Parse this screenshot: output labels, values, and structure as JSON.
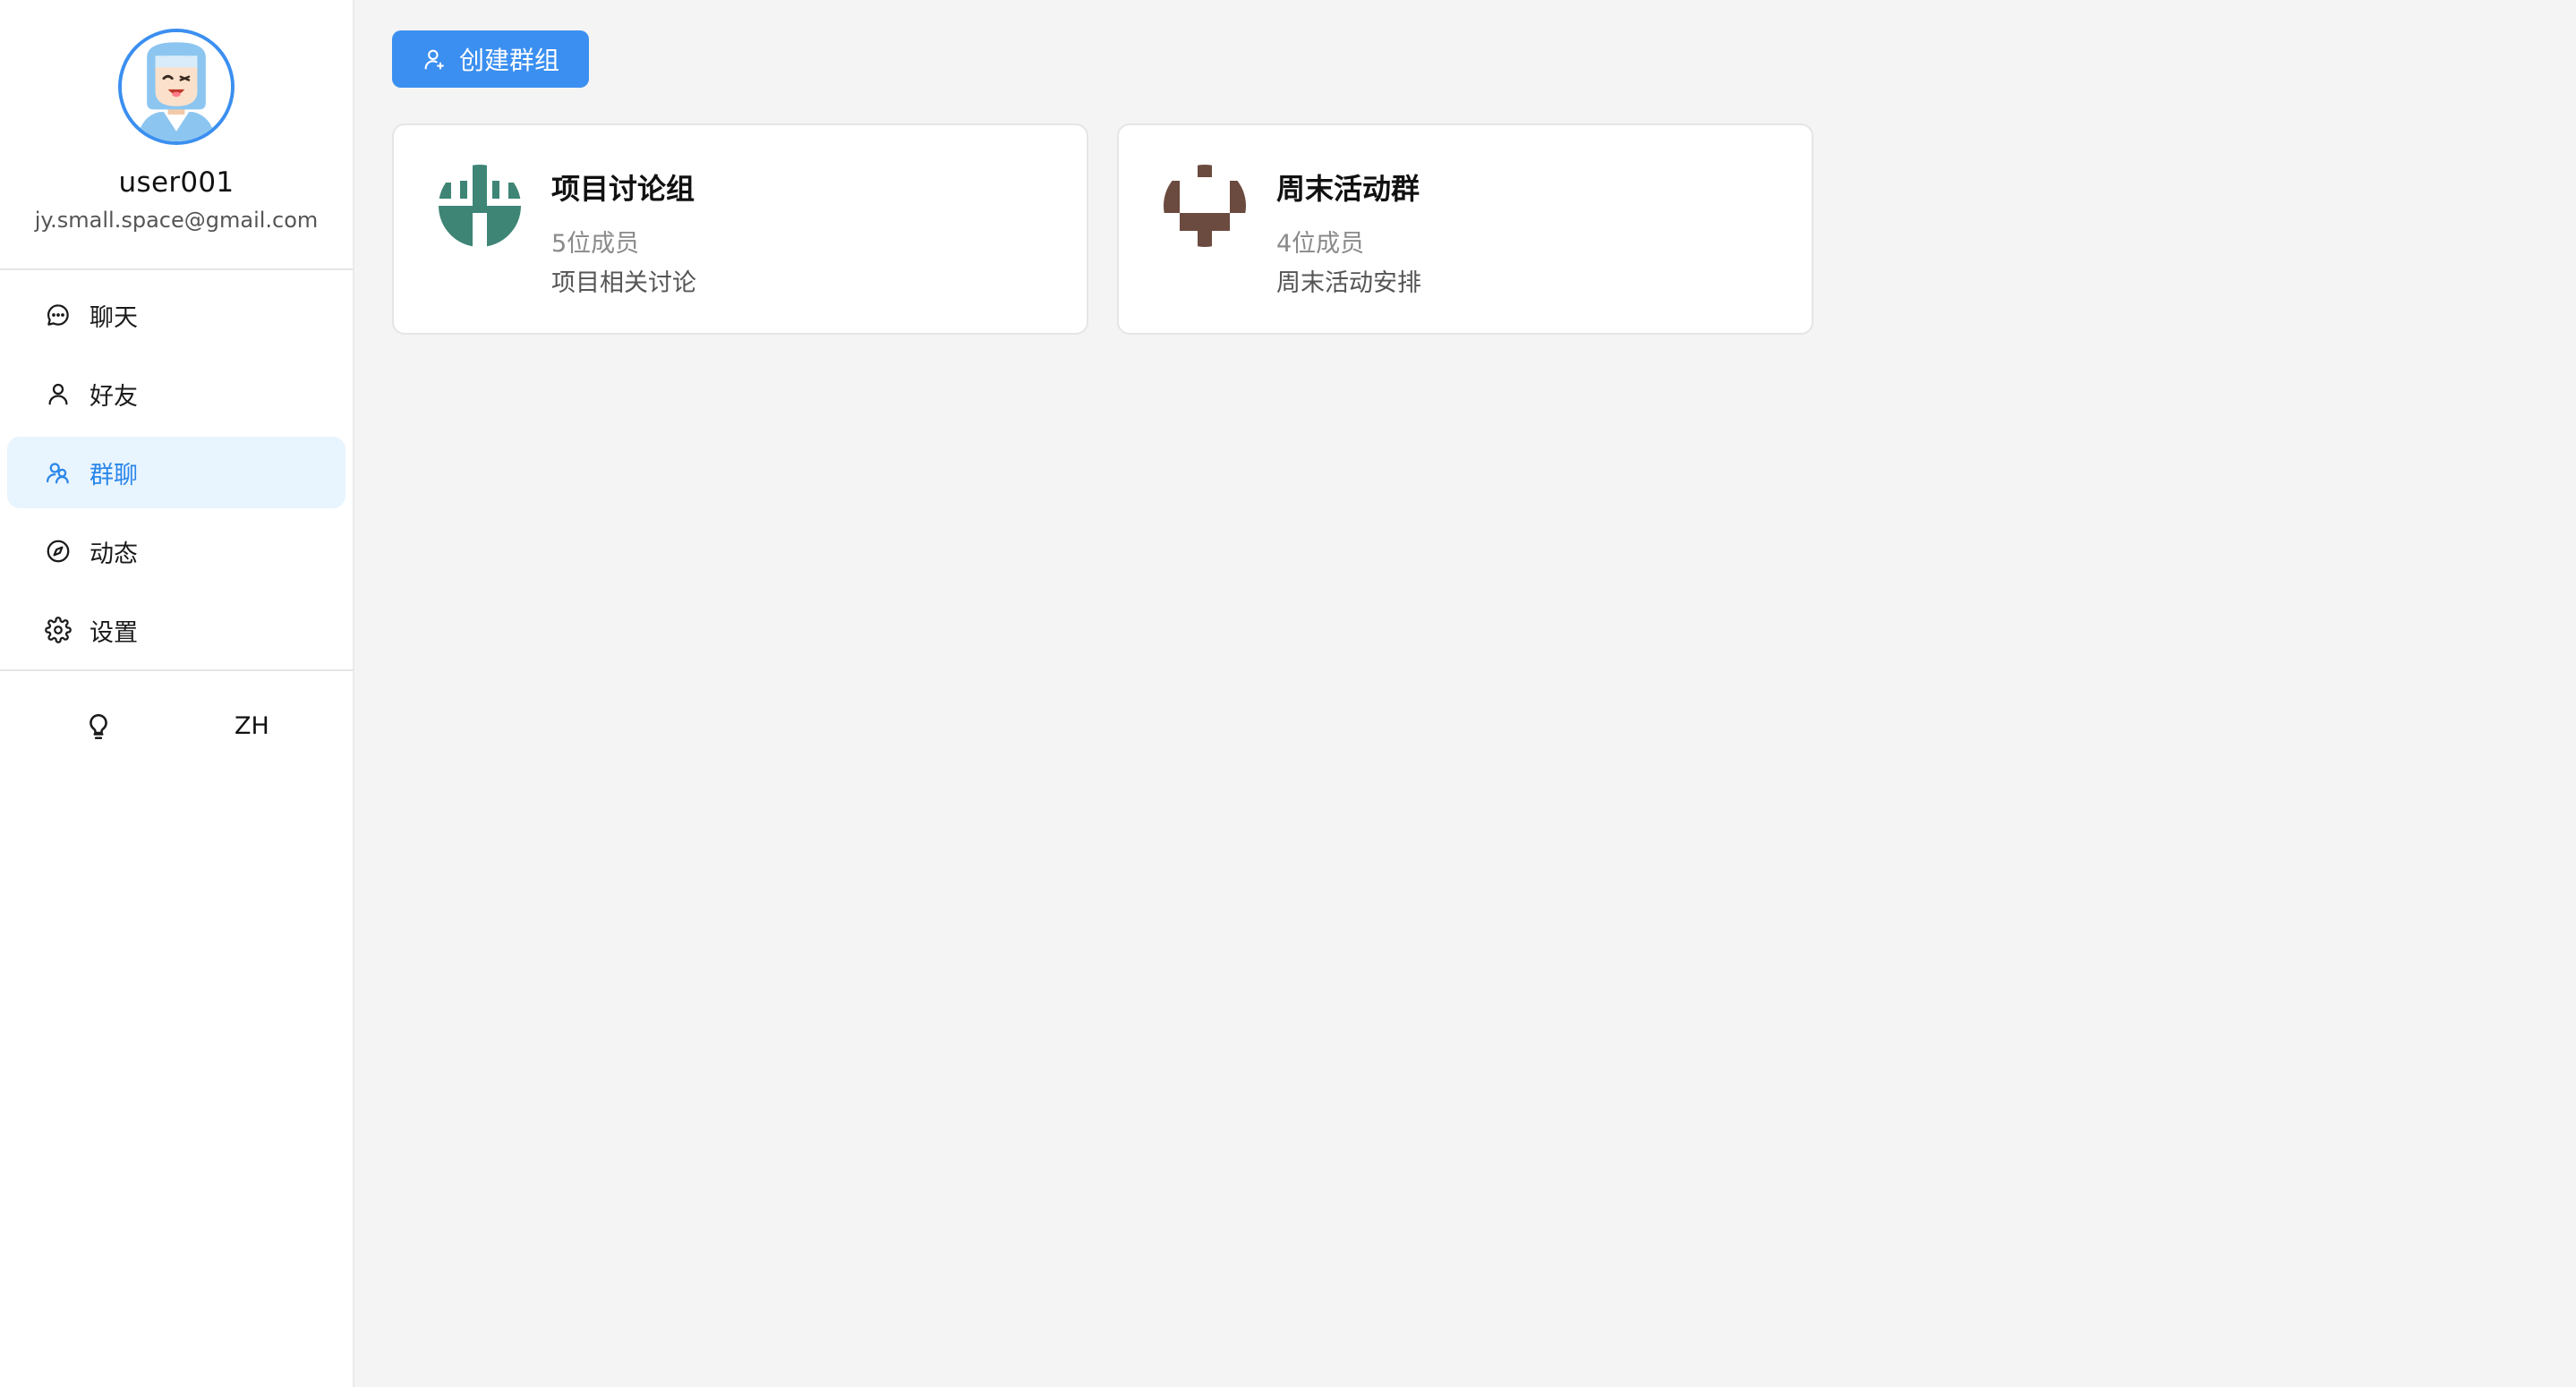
{
  "profile": {
    "username": "user001",
    "email": "jy.small.space@gmail.com"
  },
  "nav": {
    "items": [
      {
        "label": "聊天",
        "icon": "chat-bubble-icon"
      },
      {
        "label": "好友",
        "icon": "user-icon"
      },
      {
        "label": "群聊",
        "icon": "users-icon",
        "active": true
      },
      {
        "label": "动态",
        "icon": "compass-icon"
      },
      {
        "label": "设置",
        "icon": "gear-icon"
      }
    ]
  },
  "footer": {
    "theme_icon": "lightbulb-icon",
    "language": "ZH"
  },
  "toolbar": {
    "create_group_label": "创建群组",
    "create_group_icon": "user-plus-icon"
  },
  "groups": [
    {
      "name": "项目讨论组",
      "members": "5位成员",
      "description": "项目相关讨论",
      "avatar_color": "#3e8576"
    },
    {
      "name": "周末活动群",
      "members": "4位成员",
      "description": "周末活动安排",
      "avatar_color": "#6b4a3f"
    }
  ],
  "colors": {
    "accent": "#3b8ff0",
    "active_nav_bg": "#e8f4fe",
    "active_nav_text": "#2a86ea"
  }
}
